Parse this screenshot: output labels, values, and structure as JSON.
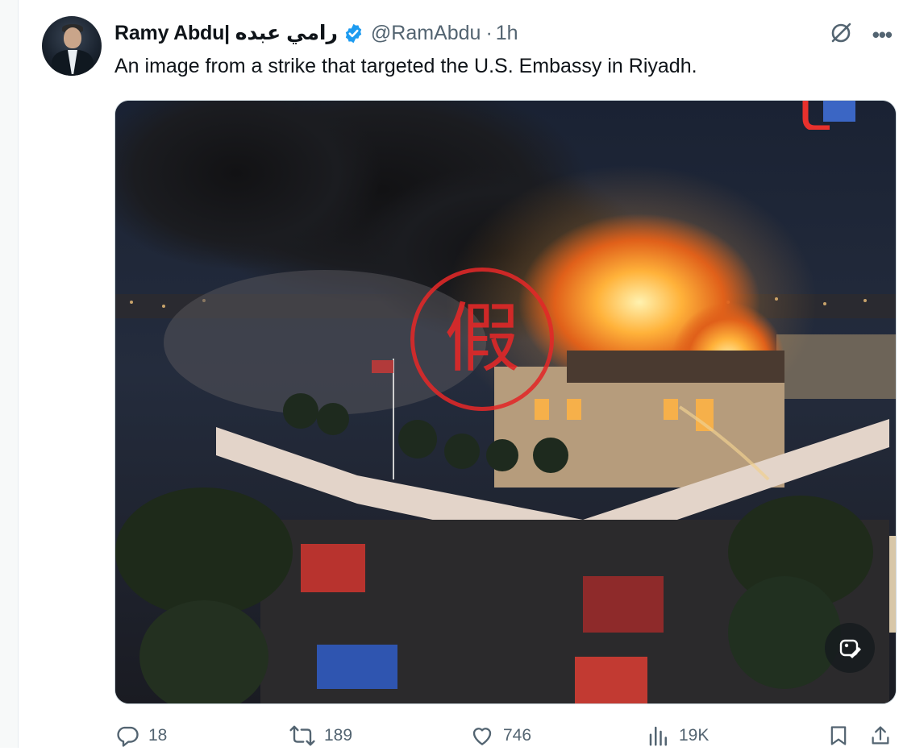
{
  "post": {
    "author_name": "Ramy Abdu| رامي عبده",
    "handle": "@RamAbdu",
    "separator": "·",
    "time": "1h",
    "text": "An image from a strike that targeted the U.S. Embassy in Riyadh.",
    "stamp_char": "假"
  },
  "actions": {
    "replies": "18",
    "reposts": "189",
    "likes": "746",
    "views": "19K"
  },
  "icons": {
    "verified": "verified-badge-icon",
    "grok": "grok-icon",
    "more": "more-icon",
    "reply": "reply-icon",
    "repost": "repost-icon",
    "like": "heart-icon",
    "views": "views-icon",
    "bookmark": "bookmark-icon",
    "share": "share-icon",
    "alt_edit": "image-edit-icon"
  },
  "colors": {
    "verified_blue": "#1d9bf0",
    "secondary_text": "#536471",
    "stamp_red": "#e12828"
  }
}
